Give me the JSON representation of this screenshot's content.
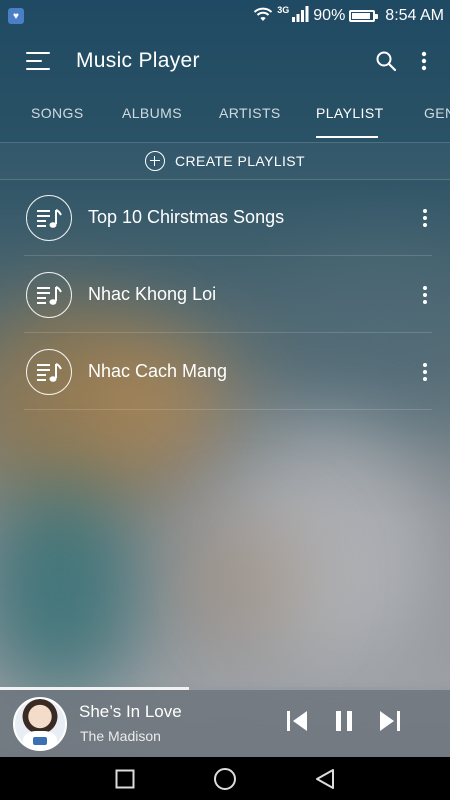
{
  "status_bar": {
    "network_type": "3G",
    "battery_percent_text": "90%",
    "battery_level": 0.9,
    "time": "8:54 AM",
    "icons": [
      "notification-icon",
      "wifi-icon",
      "signal-icon",
      "battery-icon"
    ]
  },
  "toolbar": {
    "title": "Music Player",
    "icons": [
      "menu-icon",
      "search-icon",
      "more-vert-icon"
    ]
  },
  "tabs": [
    {
      "label": "SONGS",
      "active": false
    },
    {
      "label": "ALBUMS",
      "active": false
    },
    {
      "label": "ARTISTS",
      "active": false
    },
    {
      "label": "PLAYLIST",
      "active": true
    },
    {
      "label": "GEN",
      "active": false
    }
  ],
  "create_playlist": {
    "label": "CREATE PLAYLIST",
    "icon": "add-circle-icon"
  },
  "playlists": [
    {
      "name": "Top 10 Chirstmas Songs",
      "icon": "playlist-music-icon"
    },
    {
      "name": "Nhac Khong Loi",
      "icon": "playlist-music-icon"
    },
    {
      "name": "Nhac Cach Mang",
      "icon": "playlist-music-icon"
    }
  ],
  "now_playing": {
    "title": "She’s In Love",
    "artist": "The Madison",
    "progress": 0.42,
    "icons": [
      "previous-icon",
      "pause-icon",
      "next-icon"
    ]
  },
  "nav_bar": {
    "icons": [
      "recents-icon",
      "home-icon",
      "back-icon"
    ]
  },
  "colors": {
    "accent": "#ffffff",
    "navbar": "#000000"
  }
}
